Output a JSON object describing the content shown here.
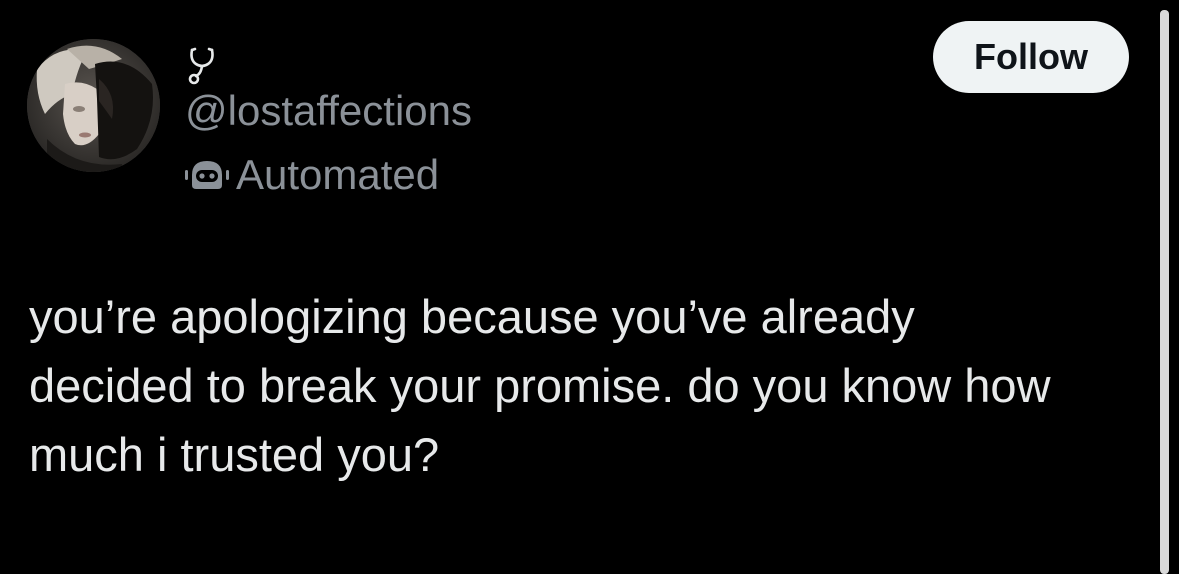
{
  "post": {
    "author": {
      "display_name_icon": "stethoscope-icon",
      "handle": "@lostaffections",
      "badge_icon": "robot-icon",
      "badge_label": "Automated"
    },
    "follow_label": "Follow",
    "text_lines": [
      "you’re apologizing because you’ve already",
      "decided to break your promise. do you know how",
      "much i trusted you?"
    ]
  },
  "colors": {
    "background": "#000000",
    "primary_text": "#e7e9ea",
    "secondary_text": "#8b9198",
    "follow_button_bg": "#eff3f4",
    "follow_button_text": "#0f1419"
  }
}
